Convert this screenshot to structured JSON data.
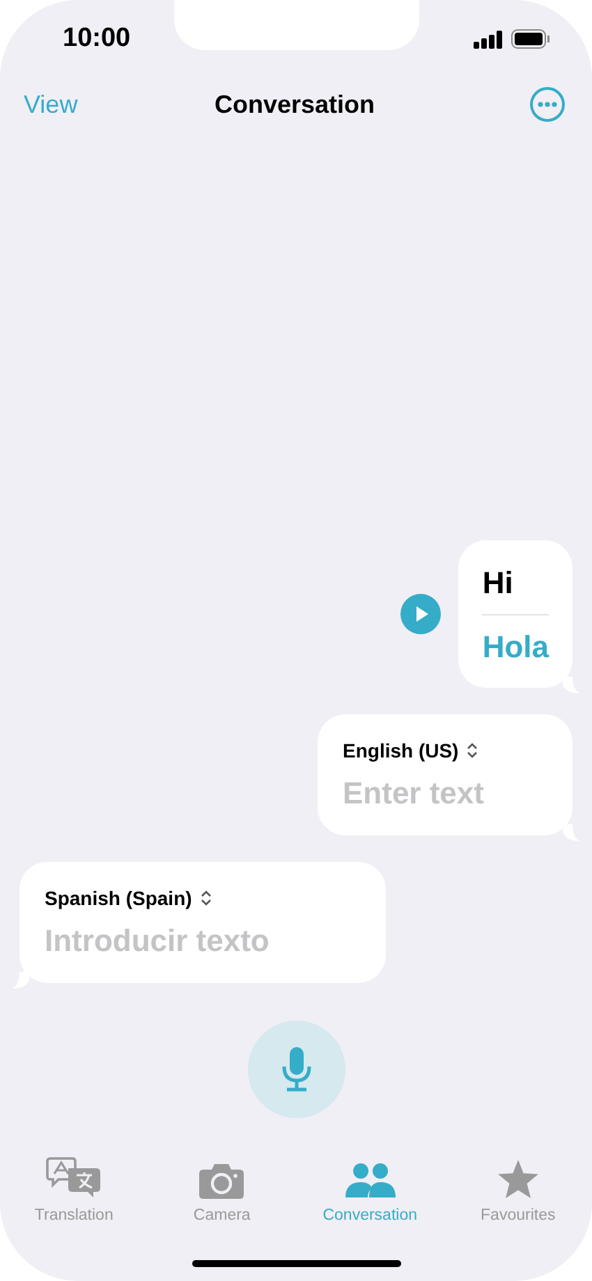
{
  "status": {
    "time": "10:00"
  },
  "nav": {
    "left": "View",
    "title": "Conversation"
  },
  "messages": [
    {
      "kind": "translation",
      "outgoing": true,
      "source": "Hi",
      "target": "Hola"
    },
    {
      "kind": "input",
      "outgoing": true,
      "language": "English (US)",
      "placeholder": "Enter text"
    },
    {
      "kind": "input",
      "outgoing": false,
      "language": "Spanish (Spain)",
      "placeholder": "Introducir texto"
    }
  ],
  "tabs": [
    {
      "kind": "translate",
      "label": "Translation",
      "selected": false
    },
    {
      "kind": "camera",
      "label": "Camera",
      "selected": false
    },
    {
      "kind": "people",
      "label": "Conversation",
      "selected": true
    },
    {
      "kind": "star",
      "label": "Favourites",
      "selected": false
    }
  ]
}
